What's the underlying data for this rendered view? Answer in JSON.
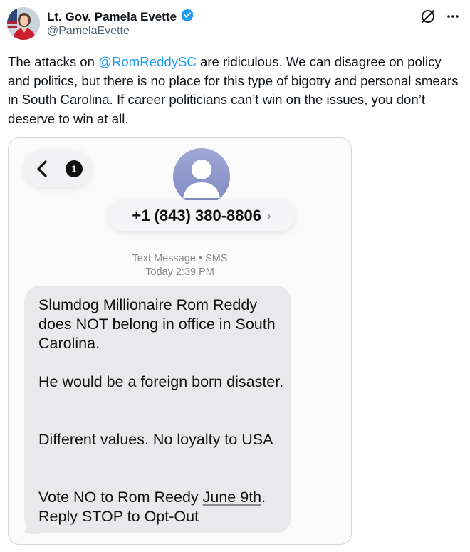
{
  "author": {
    "name": "Lt. Gov. Pamela Evette",
    "handle": "@PamelaEvette"
  },
  "tweet": {
    "text_before": "The attacks on ",
    "mention": "@RomReddySC",
    "text_after": " are ridiculous. We can disagree on policy and politics, but there is no place for this type of bigotry and personal smears in South Carolina. If career politicians can’t win on the issues, you don’t deserve to win at all."
  },
  "sms": {
    "unread_count": "1",
    "phone_number": "+1 (843) 380-8806",
    "chevron": "›",
    "meta_type": "Text Message • SMS",
    "meta_time": "Today 2:39 PM",
    "paragraph_1": "Slumdog Millionaire Rom Reddy does NOT belong in office in South Carolina.",
    "paragraph_2": "He would be a foreign born disaster.",
    "paragraph_3": "Different values. No loyalty to USA",
    "paragraph_4_before": "Vote NO to Rom Reedy ",
    "paragraph_4_date": "June 9th",
    "paragraph_4_after": ".",
    "paragraph_5": "Reply STOP to Opt-Out"
  },
  "icons": {
    "verified": "verified-badge-icon",
    "grok": "grok-icon",
    "more": "more-icon",
    "back": "back-chevron-icon",
    "contact": "contact-avatar-icon"
  },
  "colors": {
    "link": "#1d9bf0",
    "verified": "#1d9bf0",
    "bubble": "#e9e9eb"
  }
}
